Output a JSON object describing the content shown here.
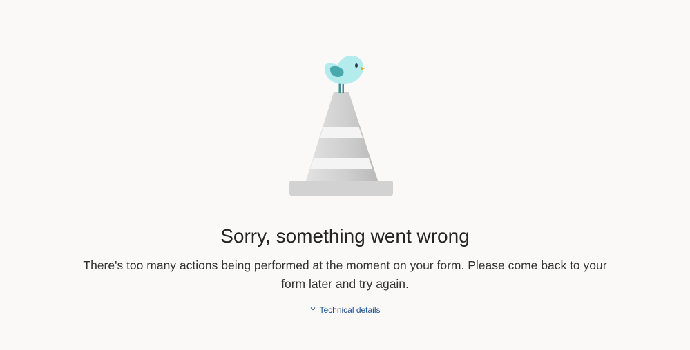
{
  "error": {
    "title": "Sorry, something went wrong",
    "message": "There's too many actions being performed at the moment on your form. Please come back to your form later and try again.",
    "details_toggle_label": "Technical details"
  },
  "colors": {
    "background": "#faf9f8",
    "title": "#252423",
    "link": "#1f4e8c",
    "cone_gray": "#c8c8c8",
    "bird": "#b4ecee"
  },
  "icons": {
    "illustration": "bird-on-traffic-cone-illustration",
    "toggle": "chevron-down-icon"
  }
}
